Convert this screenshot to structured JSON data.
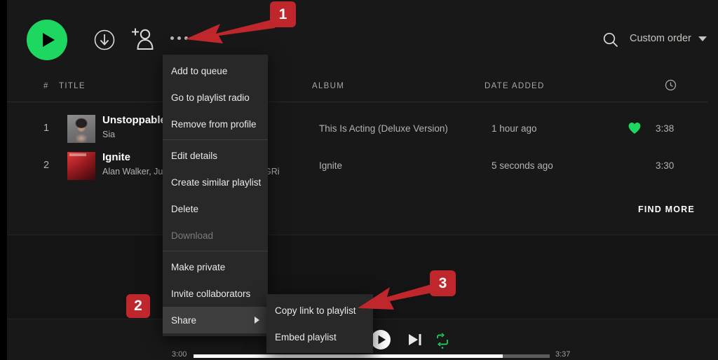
{
  "toolbar": {
    "play_label": "Play",
    "download_label": "Download",
    "add_user_label": "Invite collaborators",
    "more_label": "More options",
    "search_label": "Search in playlist",
    "sort_value": "Custom order"
  },
  "table": {
    "headers": {
      "number": "#",
      "title": "TITLE",
      "album": "ALBUM",
      "date_added": "DATE ADDED",
      "duration": "duration-clock-icon"
    },
    "rows": [
      {
        "number": "1",
        "title": "Unstoppable",
        "artist": "Sia",
        "artist_tail": "",
        "album": "This Is Acting (Deluxe Version)",
        "date_added": "1 hour ago",
        "liked": true,
        "duration": "3:38"
      },
      {
        "number": "2",
        "title": "Ignite",
        "artist": "Alan Walker, Ju",
        "artist_tail": "GRi",
        "album": "Ignite",
        "date_added": "5 seconds ago",
        "liked": false,
        "duration": "3:30"
      }
    ]
  },
  "find_more": {
    "label": "FIND MORE"
  },
  "context_menu": {
    "items": [
      {
        "label": "Add to queue",
        "state": "normal",
        "separator_after": false
      },
      {
        "label": "Go to playlist radio",
        "state": "normal",
        "separator_after": false
      },
      {
        "label": "Remove from profile",
        "state": "normal",
        "separator_after": true
      },
      {
        "label": "Edit details",
        "state": "normal",
        "separator_after": false
      },
      {
        "label": "Create similar playlist",
        "state": "normal",
        "separator_after": false
      },
      {
        "label": "Delete",
        "state": "normal",
        "separator_after": false
      },
      {
        "label": "Download",
        "state": "disabled",
        "separator_after": true
      },
      {
        "label": "Make private",
        "state": "normal",
        "separator_after": false
      },
      {
        "label": "Invite collaborators",
        "state": "normal",
        "separator_after": false
      },
      {
        "label": "Share",
        "state": "active",
        "separator_after": false,
        "has_submenu": true
      }
    ]
  },
  "share_submenu": {
    "items": [
      {
        "label": "Copy link to playlist"
      },
      {
        "label": "Embed playlist"
      }
    ]
  },
  "player": {
    "play_label": "Play",
    "next_label": "Next",
    "repeat_label": "Repeat",
    "elapsed": "3:00",
    "total": "3:37"
  },
  "annotations": {
    "badges": [
      {
        "number": "1"
      },
      {
        "number": "2"
      },
      {
        "number": "3"
      }
    ]
  },
  "colors": {
    "accent_green": "#1ed760",
    "annotation_red": "#c0272d",
    "menu_bg": "#282828",
    "page_bg": "#121212"
  }
}
